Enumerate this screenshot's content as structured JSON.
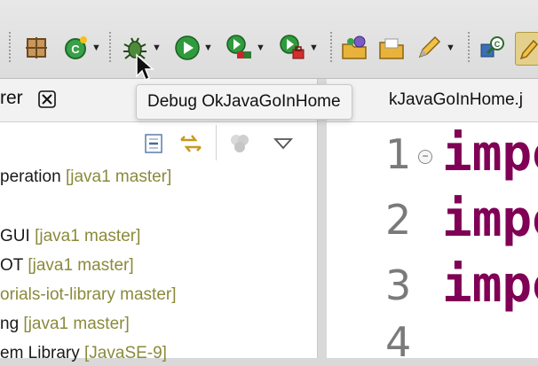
{
  "tooltip": {
    "text": "Debug OkJavaGoInHome"
  },
  "left_view": {
    "tab_title": "rer"
  },
  "tree_rows": [
    {
      "name": "peration",
      "repo": "[java1 master]"
    },
    {
      "name": "GUI",
      "repo": "[java1 master]"
    },
    {
      "name": "OT",
      "repo": "[java1 master]"
    },
    {
      "name": "orials-iot-library",
      "repo": "master]"
    },
    {
      "name": "ng",
      "repo": "[java1 master]"
    },
    {
      "name": "em Library",
      "repo": "[JavaSE-9]"
    }
  ],
  "editor": {
    "tab_title": "kJavaGoInHome.j",
    "lines": [
      {
        "num": "1",
        "code": "impo"
      },
      {
        "num": "2",
        "code": "impo"
      },
      {
        "num": "3",
        "code": "impo"
      },
      {
        "num": "4",
        "code": ""
      }
    ]
  },
  "toolbar_icons": [
    "package-icon",
    "new-class-icon",
    "debug-icon",
    "run-icon",
    "coverage-icon",
    "run-external-icon",
    "open-type-icon",
    "open-folder-icon",
    "edit-icon",
    "search-icon",
    "highlight-icon"
  ],
  "colors": {
    "keyword": "#7f0055",
    "repo_decoration": "#8a8a3c"
  }
}
